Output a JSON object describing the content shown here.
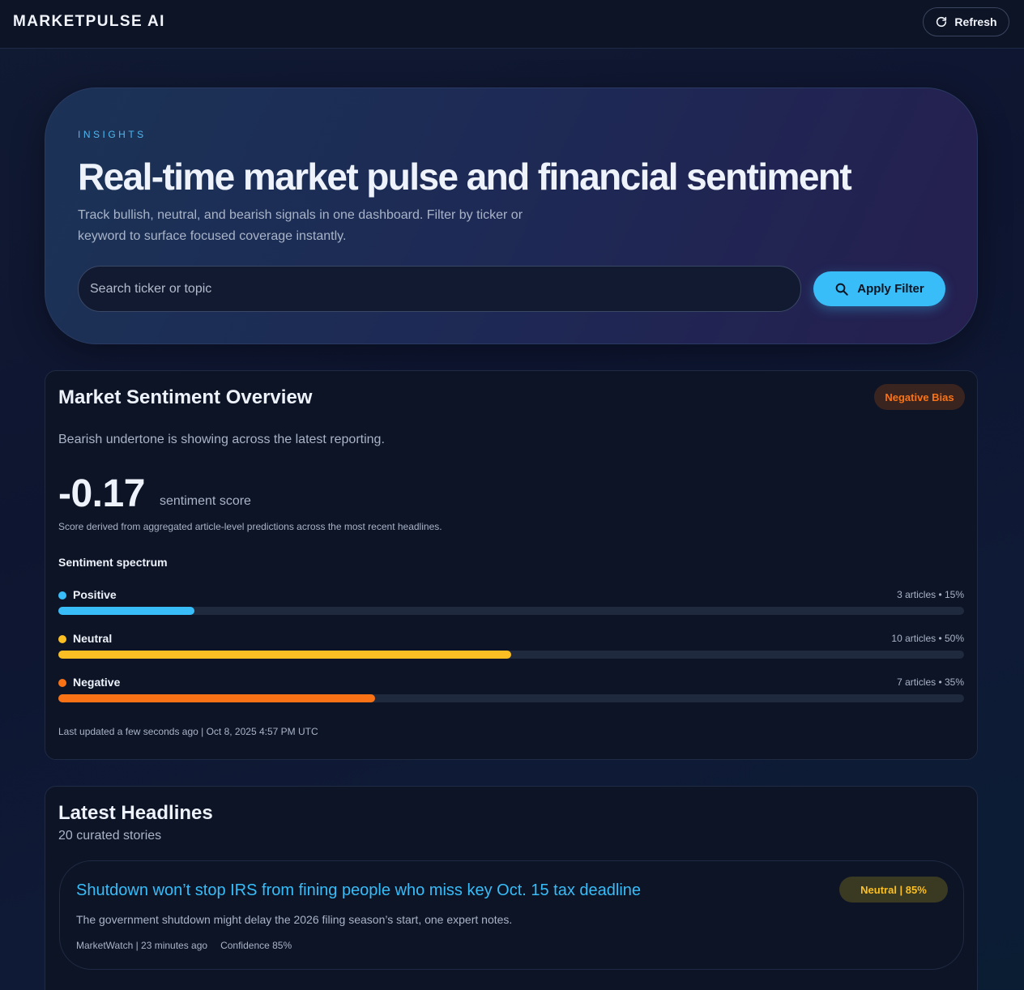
{
  "header": {
    "brand": "MARKETPULSE AI",
    "refresh_label": "Refresh",
    "refresh_icon": "refresh-icon"
  },
  "hero": {
    "eyebrow": "INSIGHTS",
    "title": "Real-time market pulse and financial sentiment",
    "subtitle": "Track bullish, neutral, and bearish signals in one dashboard. Filter by ticker or keyword to surface focused coverage instantly.",
    "search": {
      "placeholder": "Search ticker or topic",
      "value": ""
    },
    "apply_label": "Apply Filter",
    "apply_icon": "search-icon"
  },
  "overview": {
    "title": "Market Sentiment Overview",
    "bias_badge": "Negative Bias",
    "description": "Bearish undertone is showing across the latest reporting.",
    "score": "-0.17",
    "score_label": "sentiment score",
    "score_note": "Score derived from aggregated article-level predictions across the most recent headlines.",
    "spectrum_title": "Sentiment spectrum",
    "spectrum": [
      {
        "label": "Positive",
        "count_text": "3 articles • 15%",
        "percent": 15,
        "color": "#38bdf8"
      },
      {
        "label": "Neutral",
        "count_text": "10 articles • 50%",
        "percent": 50,
        "color": "#fbbf24"
      },
      {
        "label": "Negative",
        "count_text": "7 articles • 35%",
        "percent": 35,
        "color": "#f97316"
      }
    ],
    "last_updated": "Last updated a few seconds ago | Oct 8, 2025 4:57 PM UTC"
  },
  "headlines": {
    "title": "Latest Headlines",
    "count": "20 curated stories",
    "stories": [
      {
        "title": "Shutdown won’t stop IRS from fining people who miss key Oct. 15 tax deadline",
        "badge": "Neutral | 85%",
        "summary": "The government shutdown might delay the 2026 filing season’s start, one expert notes.",
        "source_time": "MarketWatch | 23 minutes ago",
        "confidence": "Confidence 85%"
      }
    ]
  },
  "colors": {
    "accent": "#38bdf8",
    "neutral": "#fbbf24",
    "negative": "#f97316"
  }
}
